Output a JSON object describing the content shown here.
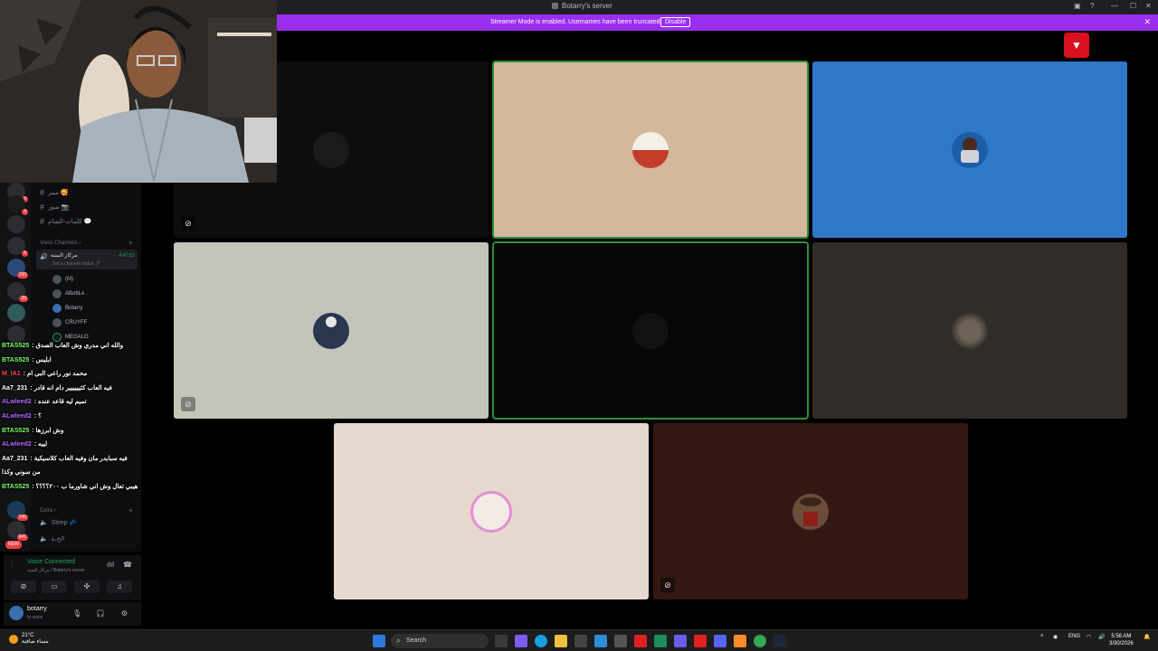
{
  "window": {
    "title": "Botarry's server"
  },
  "banner": {
    "message": "Streamer Mode is enabled. Usernames have been truncated.",
    "disable_label": "Disable",
    "close": "✕"
  },
  "tiles": [
    {
      "name": "tile-1",
      "bg": "#0d0d0d",
      "muted": true,
      "speaking": false
    },
    {
      "name": "tile-2",
      "bg": "#d4b89c",
      "muted": false,
      "speaking": true
    },
    {
      "name": "tile-3",
      "bg": "#2f77c7",
      "muted": false,
      "speaking": false
    },
    {
      "name": "tile-4",
      "bg": "#c3c5bb",
      "muted": true,
      "speaking": false
    },
    {
      "name": "tile-5",
      "bg": "#060606",
      "muted": false,
      "speaking": true
    },
    {
      "name": "tile-6",
      "bg": "#302c28",
      "muted": false,
      "speaking": false
    },
    {
      "name": "tile-7",
      "bg": "#e6d8cc",
      "muted": false,
      "speaking": false
    },
    {
      "name": "tile-8",
      "bg": "#341713",
      "muted": true,
      "speaking": false
    }
  ],
  "sidebar": {
    "channels": [
      {
        "label": "ميبر 🥰"
      },
      {
        "label": "صور 📷"
      },
      {
        "label": "كلمات-الشام 💬"
      }
    ],
    "voice_section": "Voice Channels",
    "voice_channel": {
      "name": "مركاز السنه",
      "status": "Set a channel status 🖊",
      "time": "4:47:53"
    },
    "voice_users": [
      "(M)",
      "ABo6Le .",
      "Botarry",
      "CRUYFF",
      "MEGALO"
    ],
    "extra_section": "Extra",
    "extra_channels": [
      "Sleep 💤",
      "الخ،ة"
    ],
    "new_badge": "NEW",
    "guild_badges": [
      "3",
      "4",
      "6",
      "100",
      "20",
      "146",
      "641"
    ]
  },
  "voice_panel": {
    "status": "Voice Connected",
    "location": "مركاز السنه / Botarry's server"
  },
  "user": {
    "name": "botarry",
    "status": "In voice"
  },
  "chat": [
    {
      "user": "BTAS525",
      "color": "#7cfc6a",
      "text": "والله اني مدري وش العاب الصدق"
    },
    {
      "user": "BTAS525",
      "color": "#7cfc6a",
      "text": "ابليس"
    },
    {
      "user": "M_IA1",
      "color": "#ff4b4b",
      "text": "محمد نور راعي البي ام"
    },
    {
      "user": "Aa7_231",
      "color": "#ffffff",
      "text": "فيه العاب كثيييييير دام انه قادر"
    },
    {
      "user": "ALwleed2",
      "color": "#b565ff",
      "text": "تميم ليه قاعد عنده"
    },
    {
      "user": "ALwleed2",
      "color": "#b565ff",
      "text": "؟"
    },
    {
      "user": "BTAS525",
      "color": "#7cfc6a",
      "text": "وش ابرزها"
    },
    {
      "user": "ALwleed2",
      "color": "#b565ff",
      "text": "لييه"
    },
    {
      "user": "Aa7_231",
      "color": "#ffffff",
      "text": "فيه سبايدر مان وفيه العاب كلاسيكية"
    },
    {
      "user": "",
      "color": "#ffffff",
      "text": "من سوني وكذا"
    },
    {
      "user": "BTAS525",
      "color": "#7cfc6a",
      "text": "هيبي تعال وش اني شاورما ب ٢٠٠؟؟؟؟"
    }
  ],
  "taskbar": {
    "weather_temp": "21°C",
    "weather_desc": "مساء صافية",
    "search_placeholder": "Search",
    "lang": "ENG",
    "time": "5:56 AM",
    "date": "3/30/2026"
  }
}
